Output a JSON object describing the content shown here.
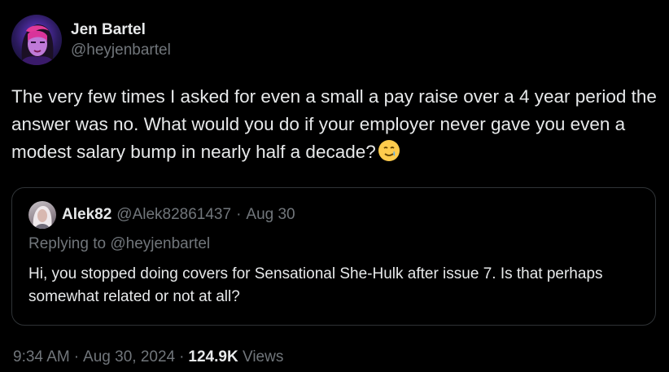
{
  "author": {
    "display_name": "Jen Bartel",
    "handle": "@heyjenbartel"
  },
  "tweet": {
    "text": "The very few times I asked for even a small a pay raise over a 4 year period the answer was no. What would you do if your employer never gave you even a modest salary bump in nearly half a decade?",
    "emoji": "smiling-face-with-tear"
  },
  "quote": {
    "display_name": "Alek82",
    "handle": "@Alek82861437",
    "dot": "·",
    "date": "Aug 30",
    "replying_to": "Replying to @heyjenbartel",
    "text": "Hi, you stopped doing covers for Sensational She-Hulk after issue 7. Is that perhaps somewhat related or not at all?"
  },
  "meta": {
    "time": "9:34 AM",
    "date": "Aug 30, 2024",
    "views_count": "124.9K",
    "views_label": "Views",
    "sep": "·"
  },
  "colors": {
    "background": "#000000",
    "text": "#e7e9ea",
    "secondary": "#71767b",
    "border": "#2f3336"
  }
}
